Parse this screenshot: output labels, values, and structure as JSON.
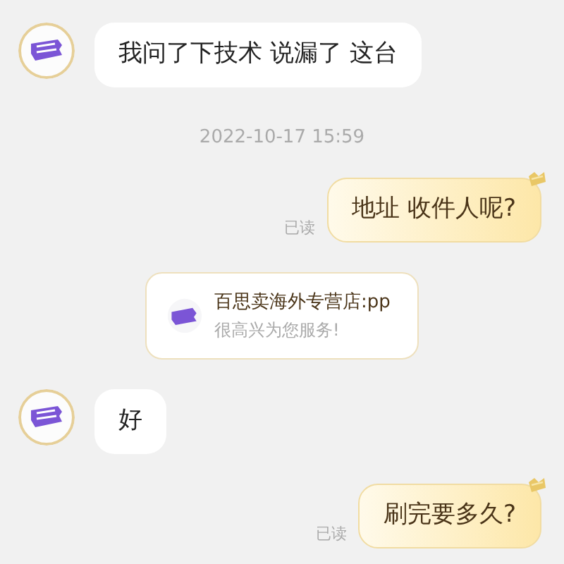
{
  "messages": [
    {
      "kind": "incoming",
      "text": "我问了下技术  说漏了 这台"
    },
    {
      "kind": "time",
      "text": "2022-10-17 15:59"
    },
    {
      "kind": "outgoing",
      "text": "地址 收件人呢?",
      "read_label": "已读"
    },
    {
      "kind": "card",
      "title": "百思卖海外专营店:pp",
      "subtitle": "很高兴为您服务!"
    },
    {
      "kind": "incoming",
      "text": "好"
    },
    {
      "kind": "outgoing",
      "text": "刷完要多久?",
      "read_label": "已读"
    }
  ]
}
